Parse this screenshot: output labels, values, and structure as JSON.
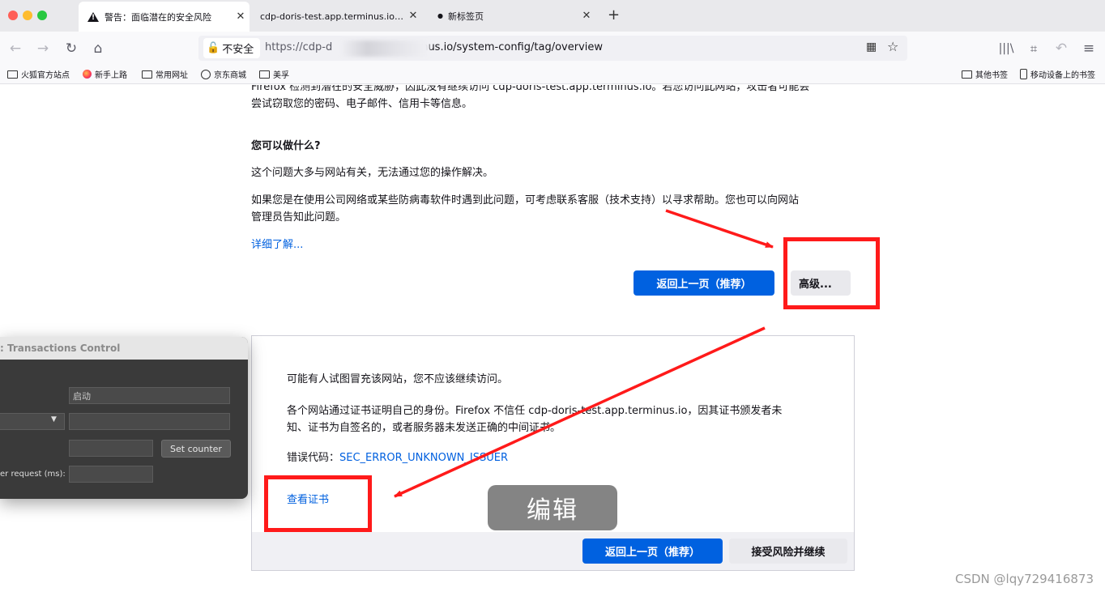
{
  "tabs": [
    {
      "title": "警告：面临潜在的安全风险",
      "active": true
    },
    {
      "title": "cdp-doris-test.app.terminus.io 的证书",
      "active": false
    },
    {
      "title": "新标签页",
      "active": false
    }
  ],
  "nav": {
    "security_label": "不安全",
    "url_prefix": "https://cdp-d",
    "url_suffix": "nus.io/system-config/tag/overview"
  },
  "bookmarks": {
    "left": [
      "火狐官方站点",
      "新手上路",
      "常用网址",
      "京东商城",
      "美孚"
    ],
    "right": [
      "其他书签",
      "移动设备上的书签"
    ]
  },
  "page": {
    "intro_line1": "Firefox 检测到潜在的安全威胁，因此没有继续访问 cdp-doris-test.app.terminus.io。若您访问此网站，攻击者可能会",
    "intro_line2": "尝试窃取您的密码、电子邮件、信用卡等信息。",
    "what_heading": "您可以做什么?",
    "what_p1": "这个问题大多与网站有关，无法通过您的操作解决。",
    "what_p2_line1": "如果您是在使用公司网络或某些防病毒软件时遇到此问题，可考虑联系客服（技术支持）以寻求帮助。您也可以向网站",
    "what_p2_line2": "管理员告知此问题。",
    "learn_more": "详细了解...",
    "go_back": "返回上一页（推荐）",
    "advanced": "高级..."
  },
  "advanced_panel": {
    "p1": "可能有人试图冒充该网站，您不应该继续访问。",
    "p2_line1": "各个网站通过证书证明自己的身份。Firefox 不信任 cdp-doris-test.app.terminus.io，因其证书颁发者未",
    "p2_line2": "知、证书为自签名的，或者服务器未发送正确的中间证书。",
    "error_label": "错误代码：",
    "error_code": "SEC_ERROR_UNKNOWN_ISSUER",
    "view_cert": "查看证书",
    "go_back": "返回上一页（推荐）",
    "accept": "接受风险并继续"
  },
  "overlay": {
    "title": ": Transactions Control",
    "start_value": "启动",
    "set_counter": "Set counter",
    "request_label": "er request (ms):"
  },
  "edit_badge": "编辑",
  "watermark": "CSDN @lqy729416873",
  "colors": {
    "accent": "#0061e0",
    "annotation": "#ff1a1a"
  }
}
